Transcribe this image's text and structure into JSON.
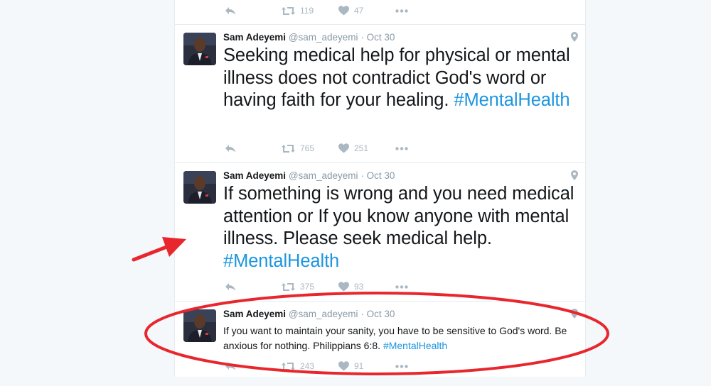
{
  "tweets": [
    {
      "name": "",
      "handle": "",
      "time": "",
      "text": "",
      "hashtag": "",
      "actions": {
        "retweets": "119",
        "likes": "47"
      }
    },
    {
      "name": "Sam Adeyemi",
      "handle": "@sam_adeyemi",
      "separator": "·",
      "time": "Oct 30",
      "text": "Seeking medical help for physical or mental illness does not contradict God's word or having faith for your healing. ",
      "hashtag": "#MentalHealth",
      "actions": {
        "retweets": "765",
        "likes": "251"
      }
    },
    {
      "name": "Sam Adeyemi",
      "handle": "@sam_adeyemi",
      "separator": "·",
      "time": "Oct 30",
      "text": "If something is wrong and you need medical attention or If you know anyone with mental illness. Please seek medical help. ",
      "hashtag": "#MentalHealth",
      "actions": {
        "retweets": "375",
        "likes": "93"
      }
    },
    {
      "name": "Sam Adeyemi",
      "handle": "@sam_adeyemi",
      "separator": "·",
      "time": "Oct 30",
      "text": "If you want to maintain your sanity, you have to be sensitive to God's word. Be anxious for nothing. Philippians 6:8. ",
      "hashtag": "#MentalHealth",
      "actions": {
        "retweets": "243",
        "likes": "91"
      }
    }
  ],
  "icons": {
    "reply": "reply-icon",
    "retweet": "retweet-icon",
    "like": "heart-icon",
    "more": "more-dots-icon",
    "location": "location-pin-icon"
  },
  "colors": {
    "hashtag": "#1b95e0",
    "annotation": "#e8262d",
    "icon": "#aab8c2",
    "meta": "#8899a6"
  }
}
